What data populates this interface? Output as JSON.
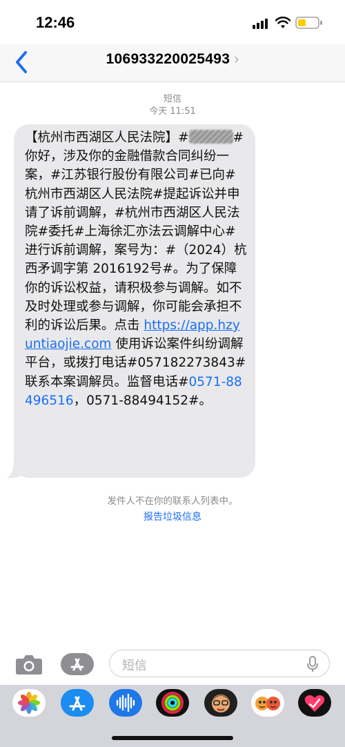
{
  "status": {
    "time": "12:46"
  },
  "nav": {
    "contact": "106933220025493",
    "chevron": "›"
  },
  "meta": {
    "service": "短信",
    "timestamp": "今天 11:51"
  },
  "message": {
    "part1": "【杭州市西湖区人民法院】#",
    "part2": "#你好，涉及你的金融借款合同纠纷一案，#江苏银行股份有限公司#已向#杭州市西湖区人民法院#提起诉讼并申请了诉前调解，#杭州市西湖区人民法院#委托#上海徐汇亦法云调解中心#进行诉前调解，案号为：#（2024）杭西矛调字第 2016192号#。为了保障你的诉讼权益，请积极参与调解。如不及时处理或参与调解，你可能会承担不利的诉讼后果。点击 ",
    "link": "https://app.hzyuntiaojie.com",
    "part3": " 使用诉讼案件纠纷调解平台，或拨打电话#057182273843#联系本案调解员。监督电话#",
    "phone_link": "0571-88496516",
    "part4": "，0571-88494152#。"
  },
  "footer": {
    "not_in_contacts": "发件人不在你的联系人列表中。",
    "report_junk": "报告垃圾信息"
  },
  "compose": {
    "placeholder": "短信"
  },
  "icons": [
    "camera-icon",
    "app-store-icon",
    "mic-icon",
    "photos-app-icon",
    "app-store-app-icon",
    "audio-app-icon",
    "fitness-app-icon",
    "memoji-app-icon",
    "memoji-stickers-app-icon",
    "heart-app-icon"
  ],
  "colors": {
    "accent": "#1a6ef5",
    "bubble": "#e9e9eb",
    "battery": "#ffcc00"
  }
}
